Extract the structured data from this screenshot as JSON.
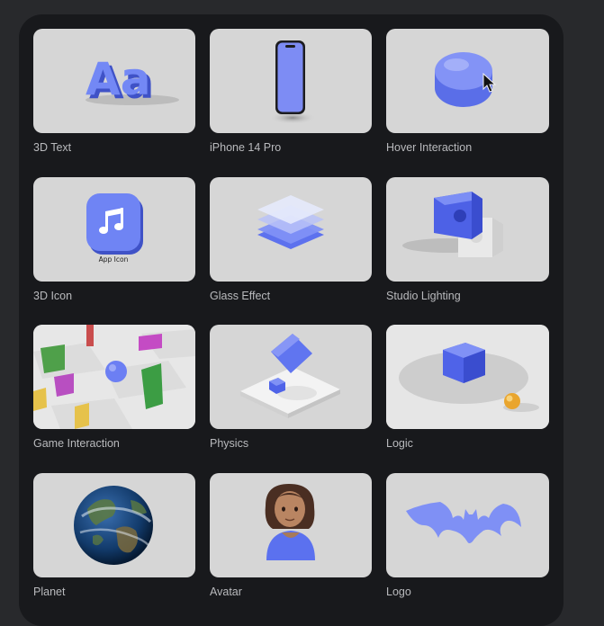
{
  "items": [
    {
      "label": "3D Text",
      "art_text": "Aa"
    },
    {
      "label": "iPhone 14 Pro"
    },
    {
      "label": "Hover Interaction"
    },
    {
      "label": "3D Icon",
      "art_text": "App Icon"
    },
    {
      "label": "Glass Effect"
    },
    {
      "label": "Studio Lighting"
    },
    {
      "label": "Game Interaction"
    },
    {
      "label": "Physics"
    },
    {
      "label": "Logic"
    },
    {
      "label": "Planet"
    },
    {
      "label": "Avatar"
    },
    {
      "label": "Logo"
    }
  ],
  "colors": {
    "accent": "#6b80f0",
    "panel": "#18191c",
    "page": "#28292c",
    "thumb_bg": "#d6d6d6",
    "label": "#b9babd"
  },
  "icons": [
    "music-note-icon",
    "cursor-icon"
  ]
}
